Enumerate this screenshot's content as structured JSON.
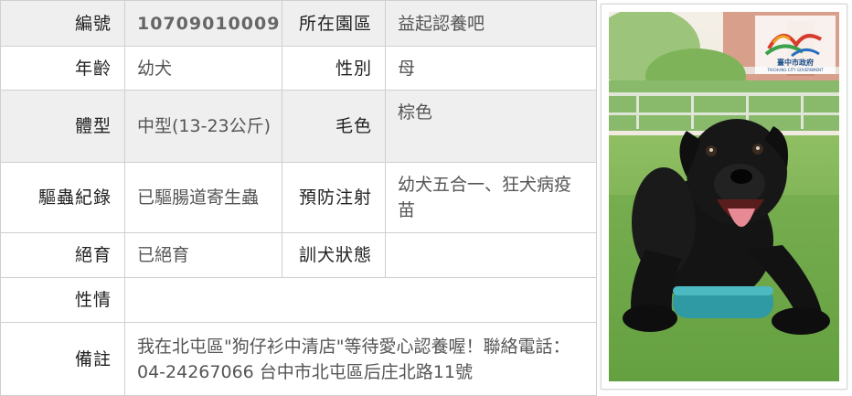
{
  "rows": [
    {
      "label_a": "編號",
      "value_a": "10709010009",
      "label_b": "所在園區",
      "value_b": "益起認養吧"
    },
    {
      "label_a": "年齡",
      "value_a": "幼犬",
      "label_b": "性別",
      "value_b": "母"
    },
    {
      "label_a": "體型",
      "value_a": "中型(13-23公斤)",
      "label_b": "毛色",
      "value_b": "棕色"
    },
    {
      "label_a": "驅蟲紀錄",
      "value_a": "已驅腸道寄生蟲",
      "label_b": "預防注射",
      "value_b": "幼犬五合一、狂犬病疫苗"
    },
    {
      "label_a": "絕育",
      "value_a": "已絕育",
      "label_b": "訓犬狀態",
      "value_b": ""
    },
    {
      "label_a": "性情",
      "value_a": ""
    },
    {
      "label_a": "備註",
      "value_a": "我在北屯區\"狗仔衫中清店\"等待愛心認養喔！聯絡電話：04-24267066 台中市北屯區后庄北路11號"
    }
  ],
  "photo": {
    "logo_text": "臺中市政府",
    "logo_subtext": "TAICHUNG CITY GOVERNMENT"
  },
  "colors": {
    "label_text": "#222222",
    "value_text": "#555555",
    "row_shade": "#efefef",
    "border": "#cfcfcf"
  }
}
